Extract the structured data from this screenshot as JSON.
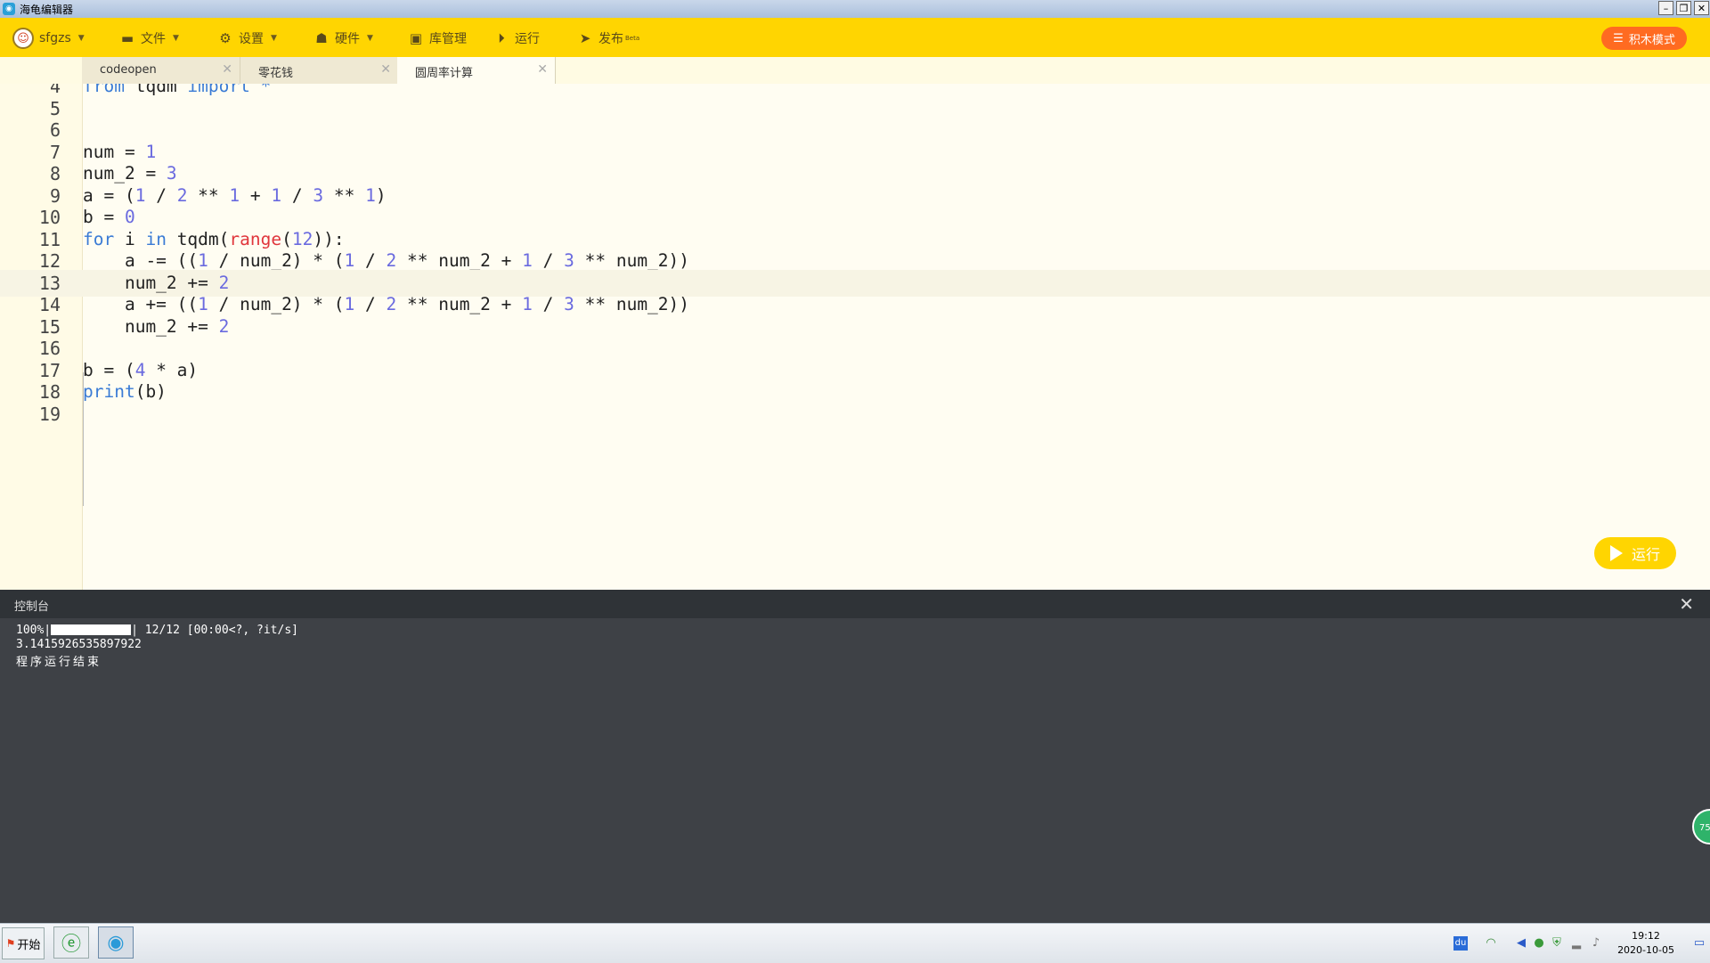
{
  "window": {
    "title": "海龟编辑器"
  },
  "toolbar": {
    "user": "sfgzs",
    "items": [
      {
        "label": "文件",
        "icon": "folder-icon"
      },
      {
        "label": "设置",
        "icon": "gear-icon"
      },
      {
        "label": "硬件",
        "icon": "hardware-icon"
      },
      {
        "label": "库管理",
        "icon": "library-icon"
      },
      {
        "label": "运行",
        "icon": "play-circle-icon"
      },
      {
        "label": "发布",
        "icon": "send-icon",
        "sup": "Beta"
      }
    ],
    "blocks_mode": "积木模式"
  },
  "tabs": [
    {
      "label": "codeopen",
      "active": false
    },
    {
      "label": "零花钱",
      "active": false
    },
    {
      "label": "圆周率计算",
      "active": true
    }
  ],
  "editor": {
    "lines": [
      {
        "n": "4",
        "code": "from tqdm import *"
      },
      {
        "n": "5",
        "code": ""
      },
      {
        "n": "6",
        "code": ""
      },
      {
        "n": "7",
        "code": "num = 1"
      },
      {
        "n": "8",
        "code": "num_2 = 3"
      },
      {
        "n": "9",
        "code": "a = (1 / 2 ** 1 + 1 / 3 ** 1)"
      },
      {
        "n": "10",
        "code": "b = 0"
      },
      {
        "n": "11",
        "code": "for i in tqdm(range(12)):"
      },
      {
        "n": "12",
        "code": "    a -= ((1 / num_2) * (1 / 2 ** num_2 + 1 / 3 ** num_2))"
      },
      {
        "n": "13",
        "code": "    num_2 += 2"
      },
      {
        "n": "14",
        "code": "    a += ((1 / num_2) * (1 / 2 ** num_2 + 1 / 3 ** num_2))"
      },
      {
        "n": "15",
        "code": "    num_2 += 2"
      },
      {
        "n": "16",
        "code": ""
      },
      {
        "n": "17",
        "code": "b = (4 * a)"
      },
      {
        "n": "18",
        "code": "print(b)"
      },
      {
        "n": "19",
        "code": ""
      }
    ],
    "highlighted_line": "13",
    "run_button": "运行"
  },
  "console": {
    "title": "控制台",
    "progress": {
      "percent_text": "100%|",
      "fill": 1.0,
      "rest": "| 12/12 [00:00<?, ?it/s]"
    },
    "output": [
      "3.1415926535897922",
      "程序运行结束"
    ]
  },
  "floating_badge": "75",
  "taskbar": {
    "start_label": "开始",
    "clock_time": "19:12",
    "clock_date": "2020-10-05",
    "tray_du": "du"
  }
}
